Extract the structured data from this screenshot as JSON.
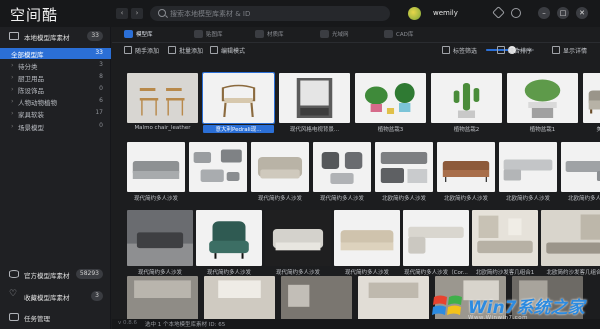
{
  "app": {
    "title": "空间酷",
    "username": "wemily"
  },
  "search": {
    "placeholder": "搜索本地模型库素材 & ID"
  },
  "nav": {
    "back": "‹",
    "forward": "›"
  },
  "window": {
    "min": "–",
    "max": "□",
    "close": "✕"
  },
  "sidebar": {
    "header_label": "本地模型库素材",
    "header_count": "33",
    "items": [
      {
        "label": "全部模型库",
        "count": "33",
        "active": true
      },
      {
        "label": "待分类",
        "count": "3"
      },
      {
        "label": "厨卫用品",
        "count": "8"
      },
      {
        "label": "陈设饰品",
        "count": "0"
      },
      {
        "label": "人物动物植物",
        "count": "6"
      },
      {
        "label": "家具软装",
        "count": "17"
      },
      {
        "label": "场景模型",
        "count": "0"
      }
    ],
    "bottom": [
      {
        "label": "官方模型库素材",
        "count": "58293"
      },
      {
        "label": "收藏模型库素材",
        "count": "3"
      },
      {
        "label": "任务管理",
        "count": ""
      }
    ],
    "version": "v 0.8.6"
  },
  "tabs": [
    {
      "label": "模型库",
      "active": true
    },
    {
      "label": "贴图库"
    },
    {
      "label": "材质库"
    },
    {
      "label": "光域网"
    },
    {
      "label": "CAD库"
    }
  ],
  "actions": {
    "left": [
      "随手添加",
      "批量添加",
      "编辑模式"
    ],
    "right": [
      "标签筛选",
      "综合排序",
      "显示详情"
    ],
    "zoom": 0.55
  },
  "grid": {
    "row1": [
      {
        "label": "Malmo chair_leather",
        "kind": "chairs"
      },
      {
        "label": "意大利Pedrali现...",
        "kind": "armchair",
        "selected": true
      },
      {
        "label": "现代风格电视背景...",
        "kind": "cabinet"
      },
      {
        "label": "植物盆栽3",
        "kind": "plants"
      },
      {
        "label": "植物盆栽2",
        "kind": "cactus"
      },
      {
        "label": "植物盆栽1",
        "kind": "cactus2"
      },
      {
        "label": "美式金丝绒布沙发",
        "kind": "sofa"
      }
    ],
    "row2": [
      {
        "label": "现代简约多人沙发",
        "kind": "grey-sofa"
      },
      {
        "label": "",
        "kind": "set"
      },
      {
        "label": "现代简约多人沙发",
        "kind": "grey-sofa2"
      },
      {
        "label": "现代简约多人沙发",
        "kind": "chair-set"
      },
      {
        "label": "北欧简约多人沙发",
        "kind": "set2"
      },
      {
        "label": "北欧简约多人沙发",
        "kind": "brown-sofa"
      },
      {
        "label": "北欧简约多人沙发",
        "kind": "sectional"
      },
      {
        "label": "北欧简约多人沙发",
        "kind": "sectional2"
      }
    ],
    "row3": [
      {
        "label": "现代简约多人沙发",
        "kind": "dark-room"
      },
      {
        "label": "现代简约多人沙发",
        "kind": "green-chair"
      },
      {
        "label": "现代简约多人沙发",
        "kind": "dark-sofa"
      },
      {
        "label": "现代简约多人沙发",
        "kind": "beige-sofa"
      },
      {
        "label": "现代简约多人沙发（Cor...",
        "kind": "corner-sofa"
      },
      {
        "label": "北欧简约沙发客几组合1",
        "kind": "room"
      },
      {
        "label": "北欧简约沙发客几组合",
        "kind": "room2"
      }
    ],
    "row4": [
      {
        "label": "",
        "kind": "room3"
      },
      {
        "label": "",
        "kind": "room4"
      },
      {
        "label": "",
        "kind": "room5"
      },
      {
        "label": "",
        "kind": "room6"
      },
      {
        "label": "",
        "kind": "room7"
      },
      {
        "label": "",
        "kind": "room8"
      }
    ]
  },
  "status": {
    "message": "选中 1 个本地模型库素材 ID: 65"
  },
  "watermark": {
    "brand": "Win7系统之家",
    "sub": "Www.Winwin7.com"
  },
  "colors": {
    "accent": "#2b6fd6",
    "bg": "#1c1d1f",
    "sidebar": "#1f2023"
  }
}
